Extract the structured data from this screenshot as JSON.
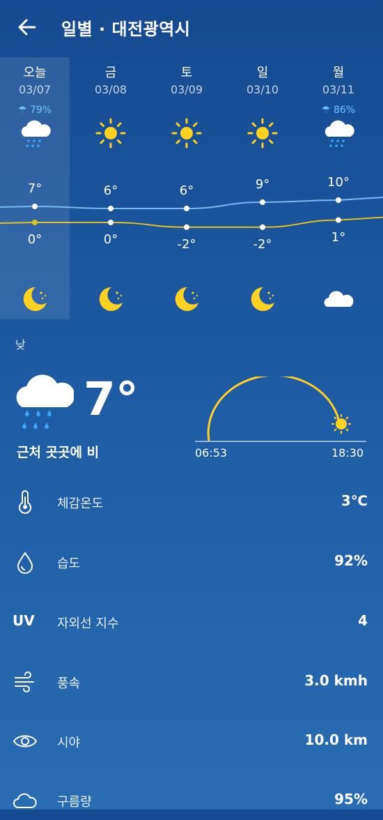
{
  "header": {
    "title": "일별 · 대전광역시",
    "back_icon": "back-arrow-icon"
  },
  "days": [
    {
      "name": "오늘",
      "date": "03/07",
      "precip": "79%",
      "day_icon": "rain-cloud-icon",
      "high": "7°",
      "low": "0°",
      "night_icon": "moon-stars-icon"
    },
    {
      "name": "금",
      "date": "03/08",
      "precip": "",
      "day_icon": "sun-icon",
      "high": "6°",
      "low": "0°",
      "night_icon": "moon-stars-icon"
    },
    {
      "name": "토",
      "date": "03/09",
      "precip": "",
      "day_icon": "sun-icon",
      "high": "6°",
      "low": "-2°",
      "night_icon": "moon-stars-icon"
    },
    {
      "name": "일",
      "date": "03/10",
      "precip": "",
      "day_icon": "sun-icon",
      "high": "9°",
      "low": "-2°",
      "night_icon": "moon-stars-icon"
    },
    {
      "name": "월",
      "date": "03/11",
      "precip": "86%",
      "day_icon": "rain-cloud-icon",
      "high": "10°",
      "low": "1°",
      "night_icon": "cloud-icon"
    }
  ],
  "chart_data": {
    "type": "line",
    "x": [
      "03/07",
      "03/08",
      "03/09",
      "03/10",
      "03/11"
    ],
    "series": [
      {
        "values": [
          7,
          6,
          6,
          9,
          10
        ]
      },
      {
        "values": [
          0,
          0,
          -2,
          -2,
          1
        ]
      }
    ]
  },
  "detail": {
    "period_label": "낮",
    "temp": "7°",
    "condition": "근처 곳곳에 비",
    "sunrise": "06:53",
    "sunset": "18:30",
    "rows": [
      {
        "label": "체감온도",
        "value": "3℃",
        "icon": "thermometer-icon"
      },
      {
        "label": "습도",
        "value": "92%",
        "icon": "humidity-drop-icon"
      },
      {
        "label": "자외선 지수",
        "value": "4",
        "icon_text": "UV"
      },
      {
        "label": "풍속",
        "value": "3.0 kmh",
        "icon": "wind-icon"
      },
      {
        "label": "시야",
        "value": "10.0 km",
        "icon": "eye-icon"
      },
      {
        "label": "구름량",
        "value": "95%",
        "icon": "cloud-cover-icon"
      }
    ]
  },
  "colors": {
    "high_line": "#7ab8f0",
    "low_line": "#e2c21e",
    "sun": "#ffd21f",
    "precip": "#6fc6ff",
    "accent_bg": "#164a91"
  }
}
